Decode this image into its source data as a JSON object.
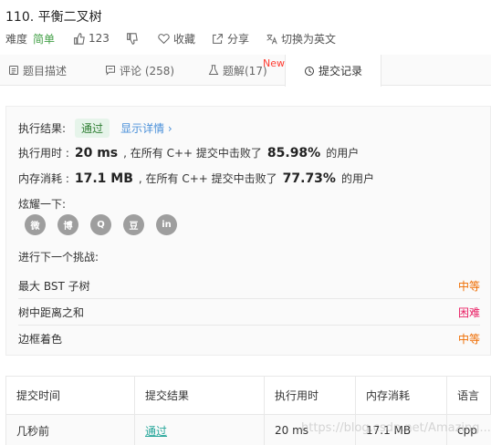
{
  "problem": {
    "title": "110. 平衡二叉树",
    "difficulty_label": "难度",
    "difficulty": "简单",
    "likes": "123",
    "favorite": "收藏",
    "share": "分享",
    "switch_lang": "切换为英文"
  },
  "tabs": [
    {
      "label": "题目描述",
      "icon": "doc-icon"
    },
    {
      "label": "评论 (258)",
      "icon": "comment-icon"
    },
    {
      "label": "题解(17)",
      "icon": "flask-icon",
      "badge": "New"
    },
    {
      "label": "提交记录",
      "icon": "clock-icon",
      "active": true
    }
  ],
  "result": {
    "status_label": "执行结果:",
    "status": "通过",
    "detail_link": "显示详情 ›",
    "runtime_label": "执行用时 :",
    "runtime": "20 ms",
    "runtime_mid": ", 在所有 C++ 提交中击败了",
    "runtime_pct": "85.98%",
    "users_suffix": "的用户",
    "memory_label": "内存消耗 :",
    "memory": "17.1 MB",
    "memory_mid": ", 在所有 C++ 提交中击败了",
    "memory_pct": "77.73%",
    "share_label": "炫耀一下:",
    "share_icons": [
      "wechat-icon",
      "weibo-icon",
      "qq-icon",
      "douban-icon",
      "linkedin-icon"
    ],
    "share_icon_text": [
      "微",
      "博",
      "Q",
      "豆",
      "in"
    ],
    "next_label": "进行下一个挑战:"
  },
  "challenges": [
    {
      "name": "最大 BST 子树",
      "level": "中等"
    },
    {
      "name": "树中距离之和",
      "level": "困难"
    },
    {
      "name": "边框着色",
      "level": "中等"
    }
  ],
  "submissions": {
    "headers": [
      "提交时间",
      "提交结果",
      "执行用时",
      "内存消耗",
      "语言"
    ],
    "rows": [
      [
        "几秒前",
        "通过",
        "20 ms",
        "17.1 MB",
        "cpp"
      ]
    ]
  },
  "watermark": "https://blog.csdn.net/Amazing..."
}
